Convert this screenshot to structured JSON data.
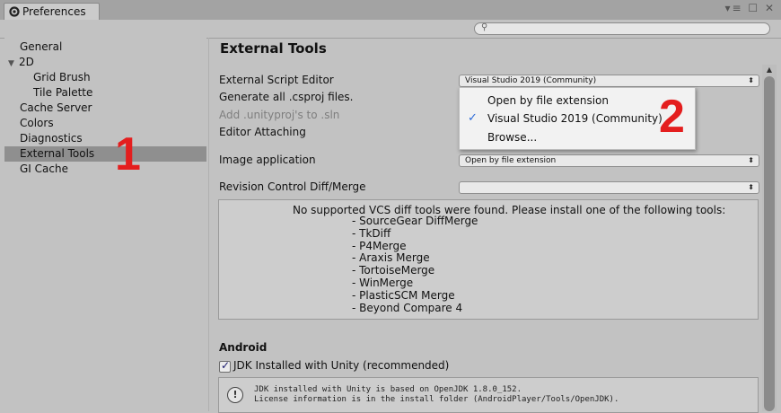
{
  "window": {
    "tab_title": "Preferences",
    "controls": [
      "▾≡",
      "☐",
      "✕"
    ]
  },
  "search": {
    "placeholder": ""
  },
  "sidebar": {
    "items": [
      {
        "label": "General",
        "indent": 0
      },
      {
        "label": "2D",
        "indent": 0,
        "expanded": true
      },
      {
        "label": "Grid Brush",
        "indent": 2
      },
      {
        "label": "Tile Palette",
        "indent": 2
      },
      {
        "label": "Cache Server",
        "indent": 0
      },
      {
        "label": "Colors",
        "indent": 0
      },
      {
        "label": "Diagnostics",
        "indent": 0
      },
      {
        "label": "External Tools",
        "indent": 0,
        "selected": true
      },
      {
        "label": "GI Cache",
        "indent": 0
      }
    ]
  },
  "main": {
    "title": "External Tools",
    "external_script_editor_label": "External Script Editor",
    "external_script_editor_value": "Visual Studio 2019 (Community)",
    "generate_csproj_label": "Generate all .csproj files.",
    "add_unityproj_label": "Add .unityproj's to .sln",
    "editor_attaching_label": "Editor Attaching",
    "image_application_label": "Image application",
    "image_application_value": "Open by file extension",
    "revision_control_label": "Revision Control Diff/Merge",
    "revision_control_value": "",
    "vcs_message": "No supported VCS diff tools were found. Please install one of the following tools:",
    "vcs_tools": [
      "- SourceGear DiffMerge",
      "- TkDiff",
      "- P4Merge",
      "- Araxis Merge",
      "- TortoiseMerge",
      "- WinMerge",
      "- PlasticSCM Merge",
      "- Beyond Compare 4"
    ],
    "android_heading": "Android",
    "jdk_checkbox_label": "JDK Installed with Unity (recommended)",
    "jdk_checked": true,
    "jdk_info_line1": "JDK installed with Unity is based on OpenJDK 1.8.0_152.",
    "jdk_info_line2": "License information is in the install folder (AndroidPlayer/Tools/OpenJDK)."
  },
  "popup": {
    "items": [
      {
        "label": "Open by file extension",
        "checked": false
      },
      {
        "label": "Visual Studio 2019 (Community)",
        "checked": true
      },
      {
        "label": "Browse...",
        "checked": false
      }
    ]
  },
  "annotations": {
    "one": "1",
    "two": "2",
    "color": "#e41e1e"
  },
  "colors": {
    "selection": "#8f8f8f",
    "check_accent": "#2a6ad8"
  }
}
